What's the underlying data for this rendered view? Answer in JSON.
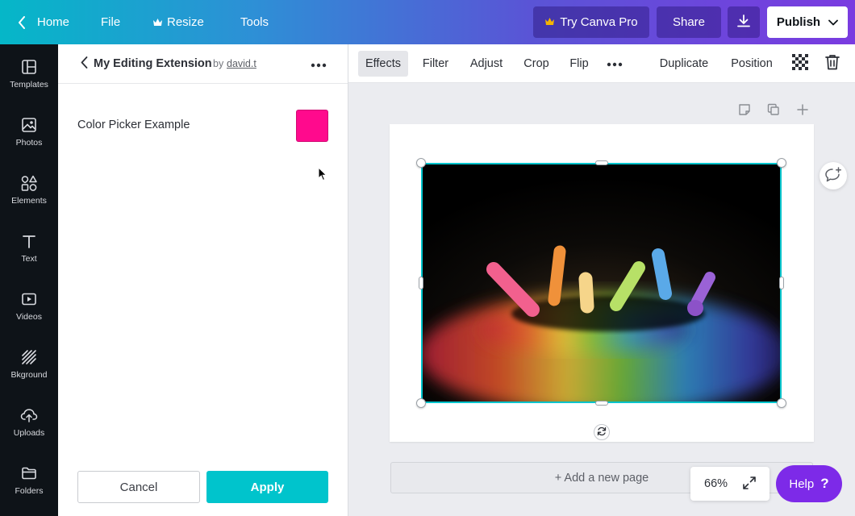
{
  "topbar": {
    "home_label": "Home",
    "file_label": "File",
    "resize_label": "Resize",
    "tools_label": "Tools",
    "try_pro_label": "Try Canva Pro",
    "share_label": "Share",
    "publish_label": "Publish"
  },
  "leftnav": {
    "items": [
      {
        "label": "Templates",
        "icon": "templates-icon"
      },
      {
        "label": "Photos",
        "icon": "photos-icon"
      },
      {
        "label": "Elements",
        "icon": "elements-icon"
      },
      {
        "label": "Text",
        "icon": "text-icon"
      },
      {
        "label": "Videos",
        "icon": "videos-icon"
      },
      {
        "label": "Bkground",
        "icon": "background-icon"
      },
      {
        "label": "Uploads",
        "icon": "uploads-icon"
      },
      {
        "label": "Folders",
        "icon": "folders-icon"
      }
    ]
  },
  "panel": {
    "title": "My Editing Extension",
    "by_label": "by",
    "author": "david.t",
    "color_picker_label": "Color Picker Example",
    "selected_color": "#ff0a8d",
    "cancel_label": "Cancel",
    "apply_label": "Apply"
  },
  "toolbar": {
    "effects_label": "Effects",
    "filter_label": "Filter",
    "adjust_label": "Adjust",
    "crop_label": "Crop",
    "flip_label": "Flip",
    "duplicate_label": "Duplicate",
    "position_label": "Position"
  },
  "canvas": {
    "add_page_label": "+ Add a new page",
    "zoom_level": "66%",
    "help_label": "Help",
    "help_icon": "?"
  },
  "colors": {
    "brand_teal": "#00c4cc",
    "help_purple": "#7d2ae8",
    "swatch_pink": "#ff0a8d"
  }
}
